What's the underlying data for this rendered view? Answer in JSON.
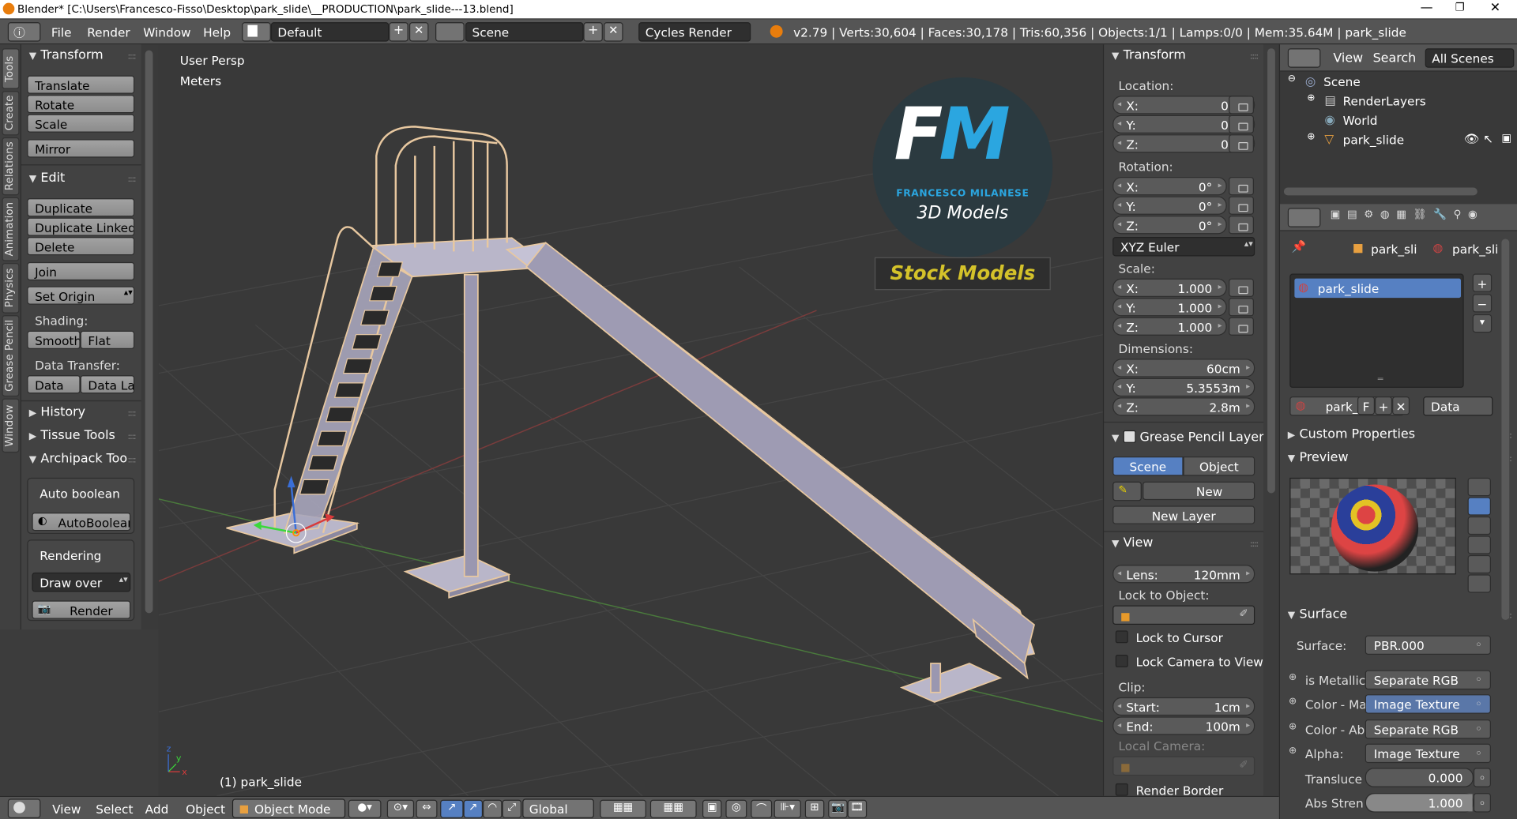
{
  "titlebar": {
    "title": "Blender* [C:\\Users\\Francesco-Fisso\\Desktop\\park_slide\\__PRODUCTION\\park_slide---13.blend]"
  },
  "menu": [
    "File",
    "Render",
    "Window",
    "Help"
  ],
  "header": {
    "layout": "Default",
    "scene": "Scene",
    "engine": "Cycles Render",
    "stats": "v2.79 | Verts:30,604 | Faces:30,178 | Tris:60,356 | Objects:1/1 | Lamps:0/0 | Mem:35.64M | park_slide"
  },
  "lefttabs": [
    "Tools",
    "Create",
    "Relations",
    "Animation",
    "Physics",
    "Grease Pencil",
    "Window"
  ],
  "tools": {
    "transform_title": "Transform",
    "translate": "Translate",
    "rotate": "Rotate",
    "scale": "Scale",
    "mirror": "Mirror",
    "edit_title": "Edit",
    "duplicate": "Duplicate",
    "duplicate_linked": "Duplicate Linked",
    "delete": "Delete",
    "join": "Join",
    "set_origin": "Set Origin",
    "shading_label": "Shading:",
    "smooth": "Smooth",
    "flat": "Flat",
    "data_transfer_label": "Data Transfer:",
    "data": "Data",
    "data_la": "Data La",
    "history": "History",
    "tissue_tools": "Tissue Tools",
    "archipack": "Archipack Too",
    "auto_boolean": "Auto boolean",
    "autoboolean_btn": "AutoBoolean",
    "rendering": "Rendering",
    "draw_over": "Draw over",
    "render": "Render"
  },
  "viewport": {
    "view_name": "User Persp",
    "units": "Meters",
    "object_label": "(1) park_slide",
    "logo": {
      "letters": "FM",
      "name": "FRANCESCO MILANESE",
      "subtitle": "3D Models",
      "tagline": "Stock Models"
    }
  },
  "npanel": {
    "transform_title": "Transform",
    "location_label": "Location:",
    "location": [
      {
        "axis": "X:",
        "value": "0m"
      },
      {
        "axis": "Y:",
        "value": "0m"
      },
      {
        "axis": "Z:",
        "value": "0m"
      }
    ],
    "rotation_label": "Rotation:",
    "rotation": [
      {
        "axis": "X:",
        "value": "0°"
      },
      {
        "axis": "Y:",
        "value": "0°"
      },
      {
        "axis": "Z:",
        "value": "0°"
      }
    ],
    "rotation_mode": "XYZ Euler",
    "scale_label": "Scale:",
    "scale": [
      {
        "axis": "X:",
        "value": "1.000"
      },
      {
        "axis": "Y:",
        "value": "1.000"
      },
      {
        "axis": "Z:",
        "value": "1.000"
      }
    ],
    "dimensions_label": "Dimensions:",
    "dimensions": [
      {
        "axis": "X:",
        "value": "60cm"
      },
      {
        "axis": "Y:",
        "value": "5.3553m"
      },
      {
        "axis": "Z:",
        "value": "2.8m"
      }
    ],
    "grease_title": "Grease Pencil Layer",
    "scene_tab": "Scene",
    "object_tab": "Object",
    "new": "New",
    "new_layer": "New Layer",
    "view_title": "View",
    "lens": "Lens:",
    "lens_value": "120mm",
    "lock_object": "Lock to Object:",
    "lock_cursor": "Lock to Cursor",
    "lock_camera": "Lock Camera to View",
    "clip_label": "Clip:",
    "clip_start": "Start:",
    "clip_start_value": "1cm",
    "clip_end": "End:",
    "clip_end_value": "100m",
    "local_camera": "Local Camera:",
    "render_border": "Render Border"
  },
  "outliner": {
    "menu_view": "View",
    "menu_search": "Search",
    "filter": "All Scenes",
    "items": [
      "Scene",
      "RenderLayers",
      "World",
      "park_slide"
    ]
  },
  "properties": {
    "crumb1": "park_sli",
    "crumb2": "park_sli",
    "material_slot": "park_slide",
    "mat_name": "park_",
    "mat_f": "F",
    "data_dropdown": "Data",
    "custom_props": "Custom Properties",
    "preview": "Preview",
    "surface_title": "Surface",
    "surface_label": "Surface:",
    "surface_value": "PBR.000",
    "inputs": [
      {
        "label": "is Metallic",
        "value": "Separate RGB"
      },
      {
        "label": "Color - Ma",
        "value": "Image Texture"
      },
      {
        "label": "Color - Ab",
        "value": "Separate RGB"
      },
      {
        "label": "Alpha:",
        "value": "Image Texture"
      }
    ],
    "translucent_label": "Transluce",
    "translucent_value": "0.000",
    "abs_label": "Abs Stren",
    "abs_value": "1.000"
  },
  "bottombar": {
    "view": "View",
    "select": "Select",
    "add": "Add",
    "object": "Object",
    "mode": "Object Mode",
    "orientation": "Global"
  }
}
